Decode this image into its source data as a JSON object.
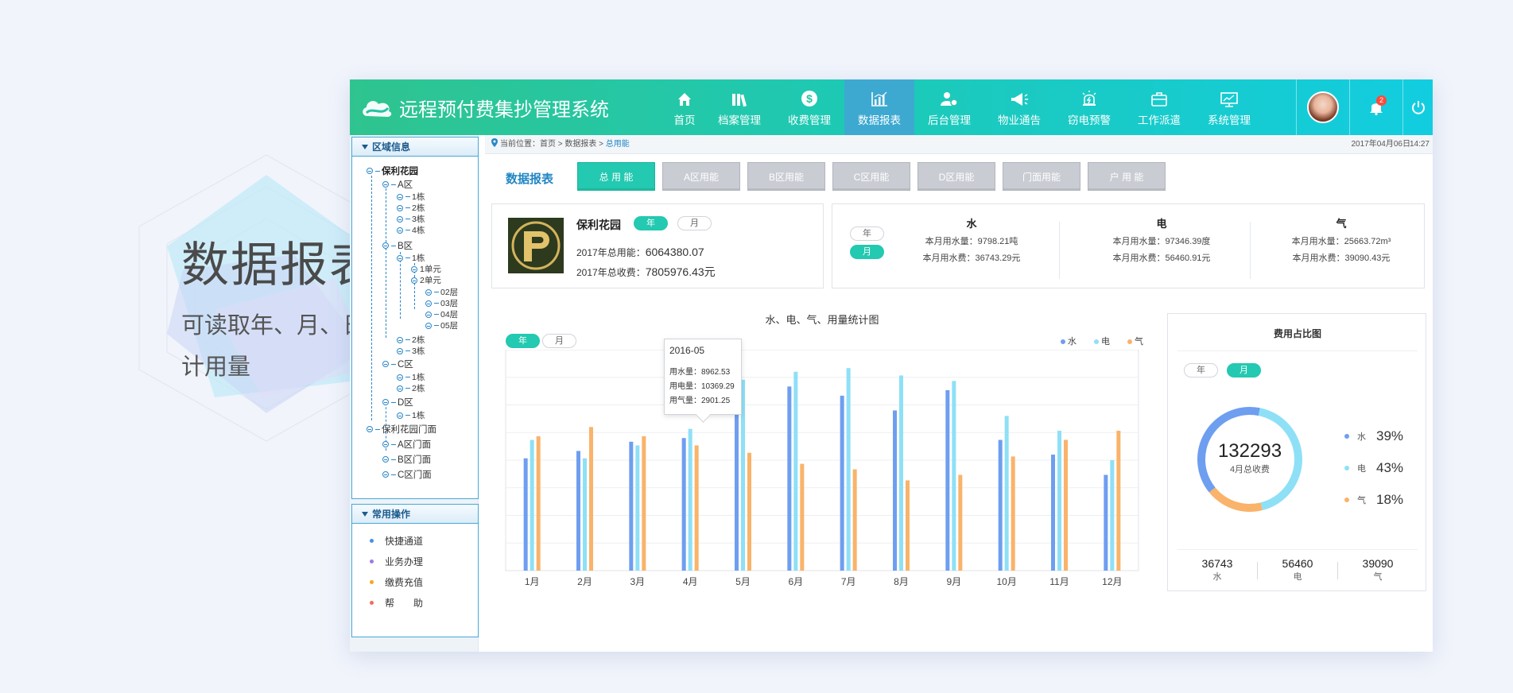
{
  "promo": {
    "title": "数据报表",
    "subtitle": "可读取年、月、日的表计用量"
  },
  "app": {
    "title": "远程预付费集抄管理系统"
  },
  "nav": [
    {
      "label": "首页",
      "icon": "home-icon"
    },
    {
      "label": "档案管理",
      "icon": "books-icon"
    },
    {
      "label": "收费管理",
      "icon": "dollar-icon"
    },
    {
      "label": "数据报表",
      "icon": "bar-chart-icon",
      "active": true
    },
    {
      "label": "后台管理",
      "icon": "user-gear-icon"
    },
    {
      "label": "物业通告",
      "icon": "megaphone-icon"
    },
    {
      "label": "窃电预警",
      "icon": "alarm-icon"
    },
    {
      "label": "工作派遣",
      "icon": "briefcase-icon"
    },
    {
      "label": "系统管理",
      "icon": "monitor-icon"
    }
  ],
  "notifications": {
    "count": "2"
  },
  "sidebar": {
    "region_title": "区域信息",
    "tree": {
      "root": "保利花园",
      "a": "A区",
      "a1": "1栋",
      "a2": "2栋",
      "a3": "3栋",
      "a4": "4栋",
      "b": "B区",
      "b1": "1栋",
      "b1u1": "1单元",
      "b1u2": "2单元",
      "f2": "02层",
      "f3": "03层",
      "f4": "04层",
      "f5": "05层",
      "b2": "2栋",
      "b3": "3栋",
      "c": "C区",
      "c1": "1栋",
      "c2": "2栋",
      "d": "D区",
      "d1": "1栋",
      "shops": "保利花园门面",
      "shopA": "A区门面",
      "shopB": "B区门面",
      "shopC": "C区门面"
    },
    "ops_title": "常用操作",
    "ops": [
      {
        "label": "快捷通道",
        "color": "#4a90e2"
      },
      {
        "label": "业务办理",
        "color": "#9b7be0"
      },
      {
        "label": "缴费充值",
        "color": "#f5a623"
      },
      {
        "label": "帮　　助",
        "color": "#f26d5b"
      }
    ]
  },
  "breadcrumb": {
    "prefix": "当前位置：首页 > 数据报表 > ",
    "current": "总用能",
    "date": "2017年04月06日",
    "time": "14:27"
  },
  "tabs": {
    "title": "数据报表",
    "items": [
      "总 用 能",
      "A区用能",
      "B区用能",
      "C区用能",
      "D区用能",
      "门面用能",
      "户 用 能"
    ]
  },
  "summary": {
    "name": "保利花园",
    "year_label": "年",
    "month_label": "月",
    "energy_label": "2017年总用能：",
    "energy_value": "6064380.07",
    "fee_label": "2017年总收费：",
    "fee_value": "7805976.43元"
  },
  "utilities": {
    "year_label": "年",
    "month_label": "月",
    "cols": [
      {
        "title": "水",
        "usage": "本月用水量：9798.21吨",
        "fee": "本月用水费：36743.29元"
      },
      {
        "title": "电",
        "usage": "本月用水量：97346.39度",
        "fee": "本月用水费：56460.91元"
      },
      {
        "title": "气",
        "usage": "本月用水量：25663.72m³",
        "fee": "本月用水费：39090.43元"
      }
    ]
  },
  "colors": {
    "water": "#6e9ef0",
    "electric": "#8ee0f6",
    "gas": "#f9b36a",
    "accent": "#23c9b0"
  },
  "bar_card": {
    "year_label": "年",
    "month_label": "月"
  },
  "tooltip": {
    "title": "2016-05",
    "water": "用水量：8962.53",
    "electric": "用电量：10369.29",
    "gas": "用气量：2901.25"
  },
  "donut_card": {
    "title": "费用占比图",
    "year_label": "年",
    "month_label": "月",
    "center_value": "132293",
    "center_label": "4月总收费",
    "legend": [
      {
        "label": "水",
        "pct": "39%"
      },
      {
        "label": "电",
        "pct": "43%"
      },
      {
        "label": "气",
        "pct": "18%"
      }
    ],
    "totals": [
      {
        "value": "36743",
        "label": "水"
      },
      {
        "value": "56460",
        "label": "电"
      },
      {
        "value": "39090",
        "label": "气"
      }
    ]
  },
  "chart_data": [
    {
      "type": "bar",
      "title": "水、电、气、用量统计图",
      "categories": [
        "1月",
        "2月",
        "3月",
        "4月",
        "5月",
        "6月",
        "7月",
        "8月",
        "9月",
        "10月",
        "11月",
        "12月"
      ],
      "series": [
        {
          "name": "水",
          "values": [
            6100,
            6500,
            7000,
            7200,
            8962.53,
            10000,
            9500,
            8700,
            9800,
            7100,
            6300,
            5200
          ]
        },
        {
          "name": "电",
          "values": [
            7100,
            6100,
            6800,
            7700,
            10369.29,
            10800,
            11000,
            10600,
            10300,
            8400,
            7600,
            6000
          ]
        },
        {
          "name": "气",
          "values": [
            7300,
            7800,
            7300,
            6800,
            6400,
            5800,
            5500,
            4900,
            5200,
            6200,
            7100,
            7600
          ]
        }
      ],
      "ylim": [
        0,
        12000
      ],
      "grid": true,
      "legend": "top-right"
    },
    {
      "type": "pie",
      "title": "费用占比图",
      "categories": [
        "水",
        "电",
        "气"
      ],
      "values": [
        39,
        43,
        18
      ]
    }
  ]
}
